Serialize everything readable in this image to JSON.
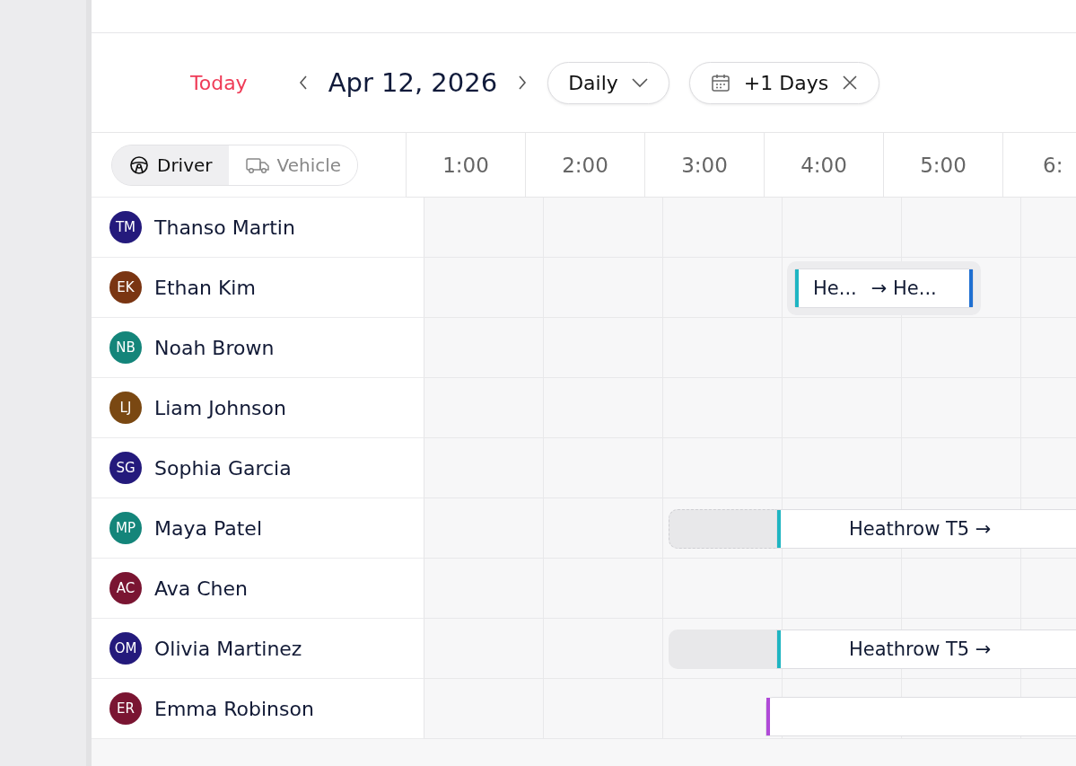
{
  "toolbar": {
    "today": "Today",
    "date": "Apr 12, 2026",
    "view": "Daily",
    "range": "+1 Days"
  },
  "resource_tabs": [
    {
      "label": "Driver",
      "selected": true
    },
    {
      "label": "Vehicle",
      "selected": false
    }
  ],
  "hours": [
    "1:00",
    "2:00",
    "3:00",
    "4:00",
    "5:00",
    "6:"
  ],
  "drivers": [
    {
      "initials": "TM",
      "name": "Thanso Martin",
      "color": "#241a7c"
    },
    {
      "initials": "EK",
      "name": "Ethan Kim",
      "color": "#7a3512",
      "events": [
        {
          "kind": "chip",
          "from": "He...",
          "to": "→ He...",
          "color": "#1fb5c2"
        }
      ]
    },
    {
      "initials": "NB",
      "name": "Noah Brown",
      "color": "#14857a"
    },
    {
      "initials": "LJ",
      "name": "Liam Johnson",
      "color": "#7a4812"
    },
    {
      "initials": "SG",
      "name": "Sophia Garcia",
      "color": "#241a7c"
    },
    {
      "initials": "MP",
      "name": "Maya Patel",
      "color": "#14857a",
      "events": [
        {
          "kind": "planned",
          "from": "Heathrow T5 →",
          "color": "#1fb5c2"
        }
      ]
    },
    {
      "initials": "AC",
      "name": "Ava Chen",
      "color": "#7a1532"
    },
    {
      "initials": "OM",
      "name": "Olivia Martinez",
      "color": "#241a7c",
      "events": [
        {
          "kind": "trip",
          "from": "Heathrow T5 →",
          "color": "#1fb5c2"
        }
      ]
    },
    {
      "initials": "ER",
      "name": "Emma Robinson",
      "color": "#7a1532",
      "events": [
        {
          "kind": "bar",
          "color": "#b04ad8"
        }
      ]
    }
  ]
}
